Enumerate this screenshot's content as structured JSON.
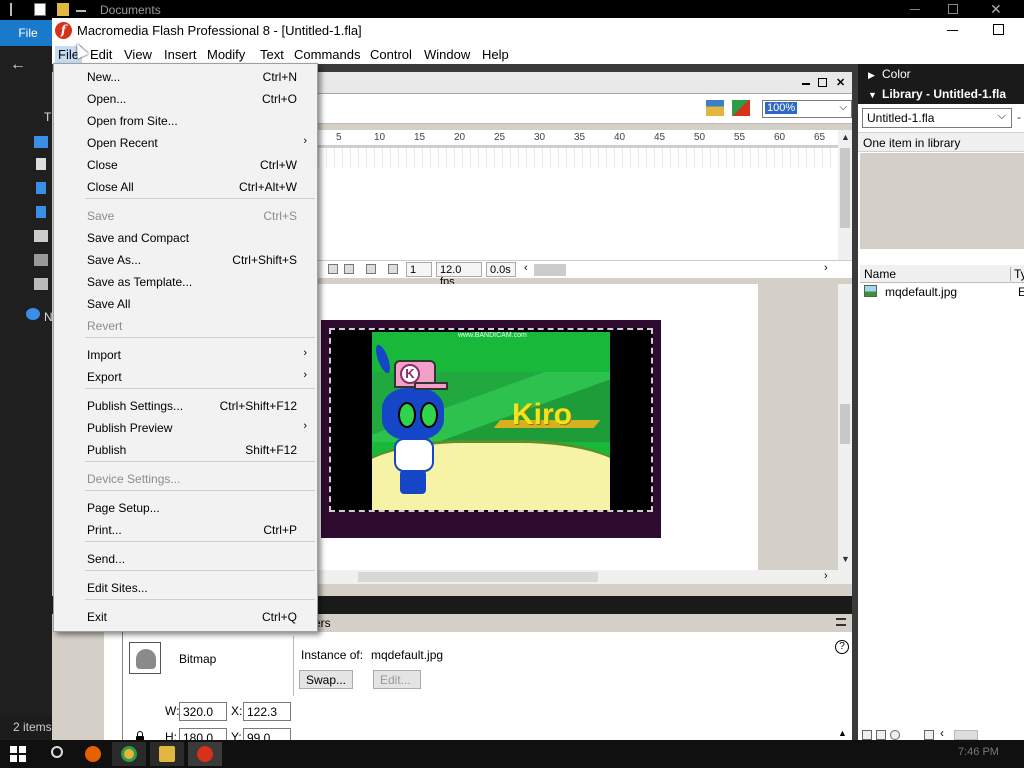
{
  "explorer": {
    "breadcrumb": "Documents",
    "file_tab": "File",
    "status_items": "2 items",
    "nav_letter_t": "T",
    "nav_letter_n": "N",
    "back_arrow": "←",
    "close_glyph": "✕"
  },
  "taskbar": {
    "clock": "7:46 PM"
  },
  "flash": {
    "title": "Macromedia Flash Professional 8 - [Untitled-1.fla]",
    "menubar": [
      "File",
      "Edit",
      "View",
      "Insert",
      "Modify",
      "Text",
      "Commands",
      "Control",
      "Window",
      "Help"
    ],
    "zoom": "100%",
    "ruler_ticks": [
      "5",
      "10",
      "15",
      "20",
      "25",
      "30",
      "35",
      "40",
      "45",
      "50",
      "55",
      "60",
      "65"
    ],
    "timeline_status": {
      "frame": "1",
      "fps": "12.0 fps",
      "time": "0.0s"
    },
    "stage_text": {
      "watermark": "www.BANDICAM.com",
      "kiro": "Kiro",
      "cap_letter": "K"
    }
  },
  "file_menu": {
    "items": [
      {
        "label": "New...",
        "shortcut": "Ctrl+N",
        "disabled": false,
        "submenu": false
      },
      {
        "label": "Open...",
        "shortcut": "Ctrl+O",
        "disabled": false,
        "submenu": false
      },
      {
        "label": "Open from Site...",
        "shortcut": "",
        "disabled": false,
        "submenu": false
      },
      {
        "label": "Open Recent",
        "shortcut": "",
        "disabled": false,
        "submenu": true
      },
      {
        "label": "Close",
        "shortcut": "Ctrl+W",
        "disabled": false,
        "submenu": false
      },
      {
        "label": "Close All",
        "shortcut": "Ctrl+Alt+W",
        "disabled": false,
        "submenu": false
      },
      {
        "label": "Save",
        "shortcut": "Ctrl+S",
        "disabled": true,
        "submenu": false
      },
      {
        "label": "Save and Compact",
        "shortcut": "",
        "disabled": false,
        "submenu": false
      },
      {
        "label": "Save As...",
        "shortcut": "Ctrl+Shift+S",
        "disabled": false,
        "submenu": false
      },
      {
        "label": "Save as Template...",
        "shortcut": "",
        "disabled": false,
        "submenu": false
      },
      {
        "label": "Save All",
        "shortcut": "",
        "disabled": false,
        "submenu": false
      },
      {
        "label": "Revert",
        "shortcut": "",
        "disabled": true,
        "submenu": false
      },
      {
        "label": "Import",
        "shortcut": "",
        "disabled": false,
        "submenu": true
      },
      {
        "label": "Export",
        "shortcut": "",
        "disabled": false,
        "submenu": true
      },
      {
        "label": "Publish Settings...",
        "shortcut": "Ctrl+Shift+F12",
        "disabled": false,
        "submenu": false
      },
      {
        "label": "Publish Preview",
        "shortcut": "",
        "disabled": false,
        "submenu": true
      },
      {
        "label": "Publish",
        "shortcut": "Shift+F12",
        "disabled": false,
        "submenu": false
      },
      {
        "label": "Device Settings...",
        "shortcut": "",
        "disabled": true,
        "submenu": false
      },
      {
        "label": "Page Setup...",
        "shortcut": "",
        "disabled": false,
        "submenu": false
      },
      {
        "label": "Print...",
        "shortcut": "Ctrl+P",
        "disabled": false,
        "submenu": false
      },
      {
        "label": "Send...",
        "shortcut": "",
        "disabled": false,
        "submenu": false
      },
      {
        "label": "Edit Sites...",
        "shortcut": "",
        "disabled": false,
        "submenu": false
      },
      {
        "label": "Exit",
        "shortcut": "Ctrl+Q",
        "disabled": false,
        "submenu": false
      }
    ],
    "submenu_glyph": "›"
  },
  "panels": {
    "color_header": "Color",
    "library_header": "Library - Untitled-1.fla",
    "library_select": "Untitled-1.fla",
    "library_count": "One item in library",
    "col_name": "Name",
    "col_type": "Ty",
    "item_name": "mqdefault.jpg",
    "item_type_initial": "E",
    "collapsed_glyph": "▶",
    "expanded_glyph": "▼",
    "dropdown_glyph": "⌵"
  },
  "properties": {
    "tab_suffix": "ers",
    "symbol_type": "Bitmap",
    "instance_label": "Instance of:",
    "instance_value": "mqdefault.jpg",
    "swap_button": "Swap...",
    "edit_button": "Edit...",
    "w_label": "W:",
    "w_value": "320.0",
    "h_label": "H:",
    "h_value": "180.0",
    "x_label": "X:",
    "x_value": "122.3",
    "y_label": "Y:",
    "y_value": "99.0",
    "help_glyph": "?"
  },
  "colors": {
    "stage_border": "#2e0b2f",
    "menu_highlight": "#c6dcf2",
    "explorer_accent": "#1979ca",
    "flash_logo": "#d7311a",
    "kiro_text": "#f2e41a"
  }
}
